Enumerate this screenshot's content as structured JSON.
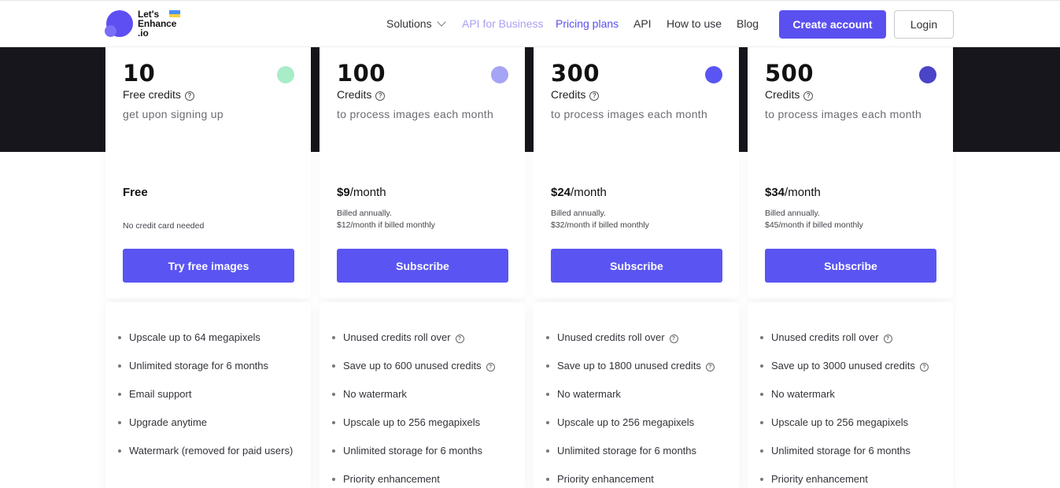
{
  "header": {
    "logo": {
      "line1": "Let's",
      "line2": "Enhance",
      "line3": ".io"
    },
    "nav": {
      "solutions": "Solutions",
      "api_business": "API for Business",
      "pricing": "Pricing plans",
      "api": "API",
      "how_to_use": "How to use",
      "blog": "Blog"
    },
    "create_account": "Create account",
    "login": "Login"
  },
  "plans": [
    {
      "credits": "10",
      "label": "Free credits",
      "desc": "get upon signing up",
      "dot_color": "#a8ecc8",
      "price_value": "Free",
      "price_period": "",
      "billing_line1": "No credit card needed",
      "billing_line2": "",
      "cta": "Try free images",
      "features": [
        "Upscale up to 64 megapixels",
        "Unlimited storage for 6 months",
        "Email support",
        "Upgrade anytime",
        "Watermark (removed for paid users)"
      ]
    },
    {
      "credits": "100",
      "label": "Credits",
      "desc": "to process images each month",
      "dot_color": "#a6a4f4",
      "price_value": "$9",
      "price_period": "/month",
      "billing_line1": "Billed annually.",
      "billing_line2": "$12/month if billed monthly",
      "cta": "Subscribe",
      "features": [
        "Unused credits roll over",
        "Save up to 600 unused credits",
        "No watermark",
        "Upscale up to 256 megapixels",
        "Unlimited storage for 6 months",
        "Priority enhancement"
      ]
    },
    {
      "credits": "300",
      "label": "Credits",
      "desc": "to process images each month",
      "dot_color": "#5a55f2",
      "price_value": "$24",
      "price_period": "/month",
      "billing_line1": "Billed annually.",
      "billing_line2": "$32/month if billed monthly",
      "cta": "Subscribe",
      "features": [
        "Unused credits roll over",
        "Save up to 1800 unused credits",
        "No watermark",
        "Upscale up to 256 megapixels",
        "Unlimited storage for 6 months",
        "Priority enhancement"
      ]
    },
    {
      "credits": "500",
      "label": "Credits",
      "desc": "to process images each month",
      "dot_color": "#4a44c6",
      "price_value": "$34",
      "price_period": "/month",
      "billing_line1": "Billed annually.",
      "billing_line2": "$45/month if billed monthly",
      "cta": "Subscribe",
      "features": [
        "Unused credits roll over",
        "Save up to 3000 unused credits",
        "No watermark",
        "Upscale up to 256 megapixels",
        "Unlimited storage for 6 months",
        "Priority enhancement"
      ]
    }
  ]
}
